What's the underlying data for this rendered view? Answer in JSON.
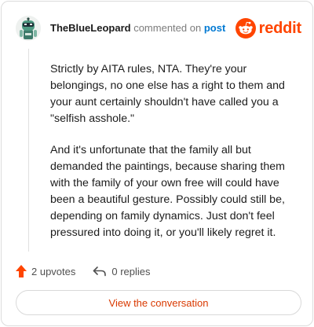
{
  "comment": {
    "author": "TheBlueLeopard",
    "action_text": "commented on",
    "post_link_text": "post",
    "paragraphs": [
      "Strictly by AITA rules, NTA. They're your belongings, no one else has a right to them and your aunt certainly shouldn't have called you a \"selfish asshole.\"",
      "And it's unfortunate that the family all but demanded the paintings, because sharing them with the family of your own free will could have been a beautiful gesture. Possibly could still be, depending on family dynamics. Just don't feel pressured into doing it, or you'll likely regret it."
    ]
  },
  "brand": {
    "name": "reddit",
    "color": "#ff4500",
    "icon": "reddit-snoo-icon"
  },
  "stats": {
    "upvotes_label": "2 upvotes",
    "replies_label": "0 replies",
    "upvote_icon": "upvote-arrow-icon",
    "reply_icon": "reply-arrow-icon",
    "upvote_color": "#ff4500"
  },
  "cta": {
    "label": "View the conversation",
    "color": "#d93900"
  },
  "colors": {
    "link": "#0079d3",
    "muted": "#7c7c7c",
    "text": "#1c1c1c"
  }
}
